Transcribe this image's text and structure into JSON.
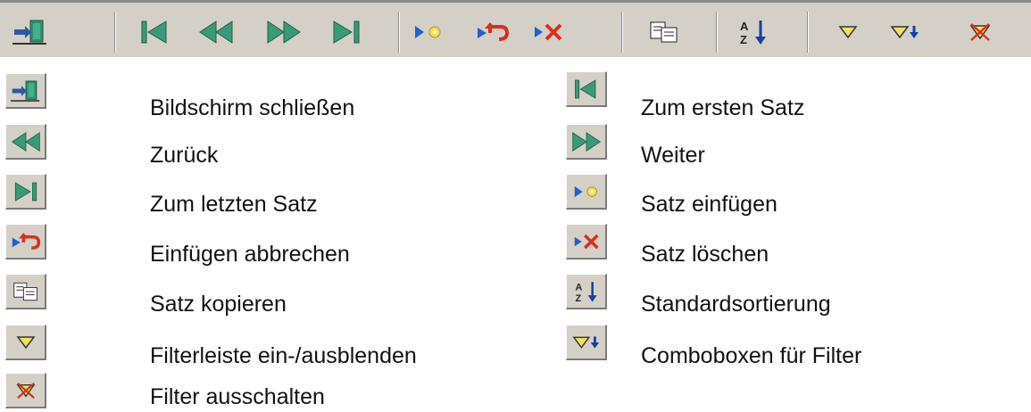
{
  "toolbar": {
    "buttons": [
      {
        "name": "exit-door-icon"
      },
      {
        "name": "first-record-icon"
      },
      {
        "name": "previous-record-icon"
      },
      {
        "name": "next-record-icon"
      },
      {
        "name": "last-record-icon"
      },
      {
        "name": "insert-record-icon"
      },
      {
        "name": "cancel-insert-icon"
      },
      {
        "name": "delete-record-icon"
      },
      {
        "name": "copy-record-icon"
      },
      {
        "name": "sort-az-icon"
      },
      {
        "name": "filter-icon"
      },
      {
        "name": "filter-combobox-icon"
      },
      {
        "name": "filter-off-icon"
      }
    ]
  },
  "legend": {
    "left": [
      {
        "icon": "exit-door-icon",
        "label": "Bildschirm schließen"
      },
      {
        "icon": "previous-record-icon",
        "label": "Zurück"
      },
      {
        "icon": "last-record-icon",
        "label": "Zum letzten Satz"
      },
      {
        "icon": "cancel-insert-icon",
        "label": "Einfügen abbrechen"
      },
      {
        "icon": "copy-record-icon",
        "label": "Satz kopieren"
      },
      {
        "icon": "filter-icon",
        "label": "Filterleiste ein-/ausblenden"
      },
      {
        "icon": "filter-off-icon",
        "label": "Filter ausschalten"
      }
    ],
    "right": [
      {
        "icon": "first-record-icon",
        "label": "Zum ersten Satz"
      },
      {
        "icon": "next-record-icon",
        "label": "Weiter"
      },
      {
        "icon": "insert-record-icon",
        "label": "Satz einfügen"
      },
      {
        "icon": "delete-record-icon",
        "label": "Satz löschen"
      },
      {
        "icon": "sort-az-icon",
        "label": "Standardsortierung"
      },
      {
        "icon": "filter-combobox-icon",
        "label": "Comboboxen für Filter"
      }
    ]
  },
  "colors": {
    "toolbar_bg": "#d4d0c8",
    "nav_green": "#3a9a78",
    "insert_blue": "#2060d0",
    "delete_red": "#d83020",
    "filter_yellow": "#f0e060"
  }
}
